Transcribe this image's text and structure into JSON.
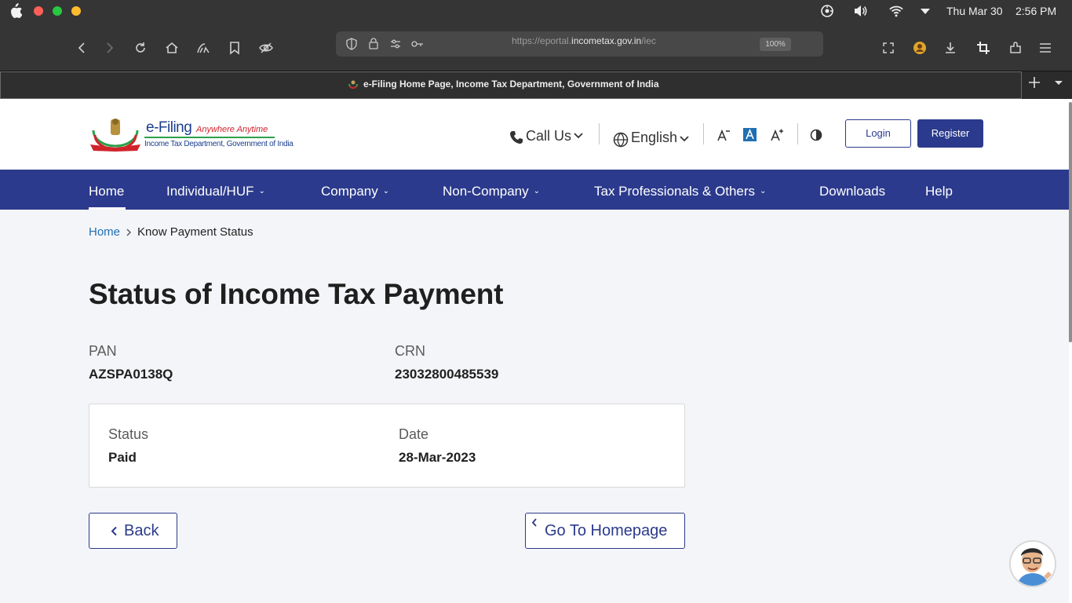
{
  "menubar": {
    "date": "Thu Mar 30",
    "time": "2:56 PM"
  },
  "browser": {
    "url_prefix": "https://eportal.",
    "url_domain": "incometax.gov.in",
    "url_suffix": "/iec",
    "zoom": "100%",
    "tab_title": "e-Filing Home Page, Income Tax Department, Government of India"
  },
  "site": {
    "logo_title": "e-Filing",
    "logo_tagline": "Anywhere Anytime",
    "logo_subtitle": "Income Tax Department, Government of India",
    "call_us": "Call Us",
    "language": "English",
    "login": "Login",
    "register": "Register"
  },
  "nav": {
    "items": [
      {
        "label": "Home"
      },
      {
        "label": "Individual/HUF"
      },
      {
        "label": "Company"
      },
      {
        "label": "Non-Company"
      },
      {
        "label": "Tax Professionals & Others"
      },
      {
        "label": "Downloads"
      },
      {
        "label": "Help"
      }
    ]
  },
  "breadcrumb": {
    "home": "Home",
    "current": "Know Payment Status"
  },
  "main": {
    "title": "Status of Income Tax Payment",
    "pan_label": "PAN",
    "pan_value": "AZSPA0138Q",
    "crn_label": "CRN",
    "crn_value": "23032800485539",
    "status_label": "Status",
    "status_value": "Paid",
    "date_label": "Date",
    "date_value": "28-Mar-2023",
    "back_label": "Back",
    "homepage_label": "Go To Homepage"
  },
  "colors": {
    "brand": "#2b3a8c",
    "link": "#1f6fb3"
  }
}
